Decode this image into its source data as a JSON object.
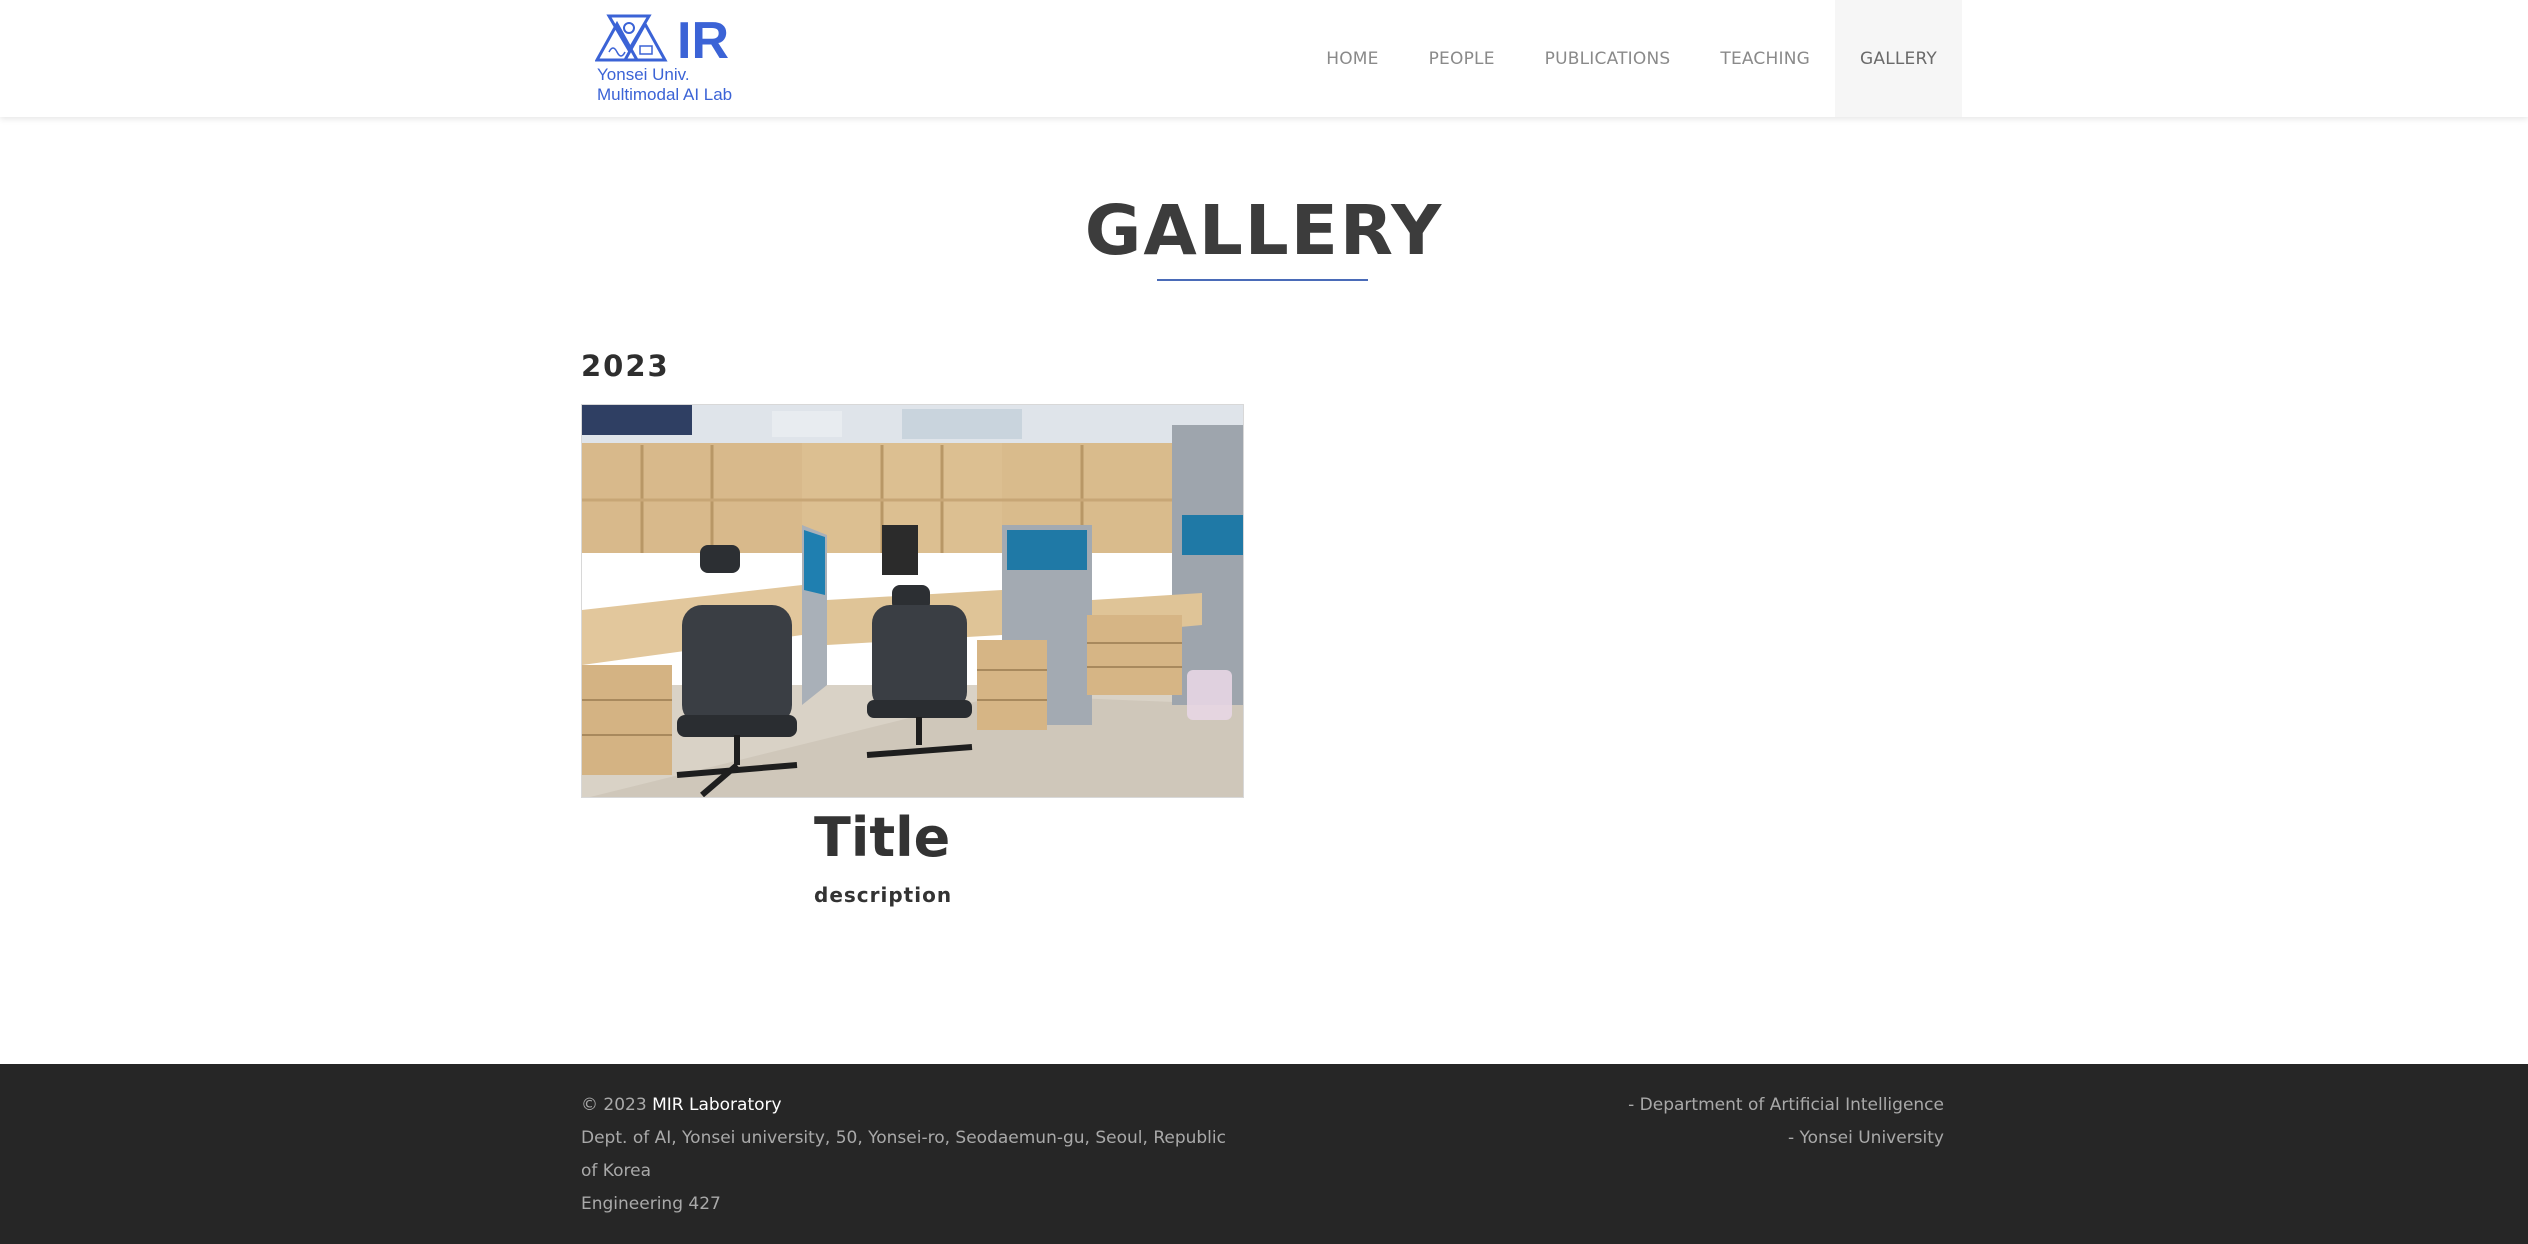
{
  "header": {
    "logo": {
      "mark_text": "IR",
      "line1": "Yonsei Univ.",
      "line2": "Multimodal AI Lab",
      "brand_color": "#3b63d6"
    },
    "nav": [
      {
        "label": "HOME"
      },
      {
        "label": "PEOPLE"
      },
      {
        "label": "PUBLICATIONS"
      },
      {
        "label": "TEACHING"
      },
      {
        "label": "GALLERY",
        "active": true
      }
    ]
  },
  "main": {
    "title": "GALLERY",
    "underline_color": "#4a6bb8",
    "year": "2023",
    "item": {
      "photo_icon": "office-desks-photo",
      "title": "Title",
      "description": "description"
    }
  },
  "footer": {
    "copyright_prefix": "© 2023",
    "lab_name": "MIR Laboratory",
    "address": "Dept. of AI, Yonsei university, 50, Yonsei-ro, Seodaemun-gu, Seoul, Republic of Korea",
    "room": "Engineering 427",
    "dept": "- Department of Artificial Intelligence",
    "university": "- Yonsei University",
    "background_color": "#262626"
  }
}
